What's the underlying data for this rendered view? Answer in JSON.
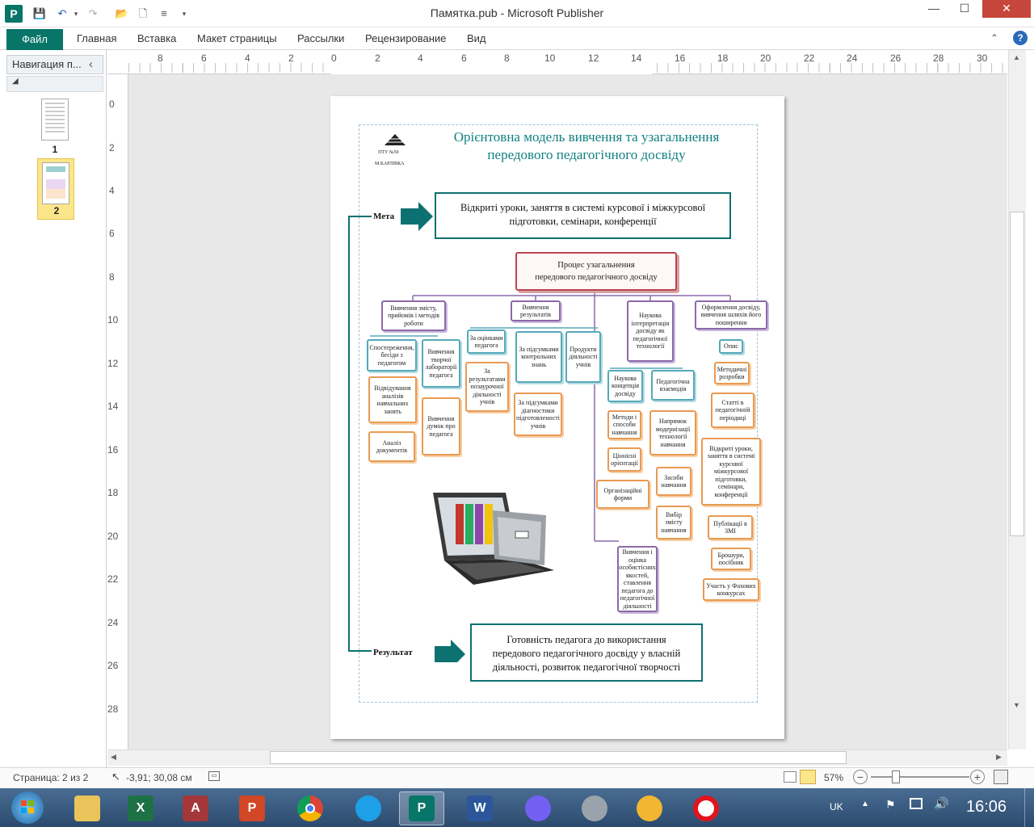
{
  "window": {
    "app_icon": "P",
    "title": "Памятка.pub  -  Microsoft Publisher",
    "controls": {
      "minimize": "—",
      "maximize": "☐",
      "close": "✕",
      "help": "?",
      "ribbon_toggle": "⌃"
    }
  },
  "quick_access": {
    "save": "💾",
    "undo": "↶",
    "redo": "↷",
    "open": "📂",
    "new": "🗋",
    "align": "≡",
    "more": "▾"
  },
  "ribbon": {
    "file_tab": "Файл",
    "tabs": [
      "Главная",
      "Вставка",
      "Макет страницы",
      "Рассылки",
      "Рецензирование",
      "Вид"
    ]
  },
  "nav_pane": {
    "title": "Навигация п...",
    "collapse": "‹",
    "section_toggle": "◢",
    "pages": [
      {
        "number": "1"
      },
      {
        "number": "2",
        "selected": true
      }
    ]
  },
  "ruler": {
    "horizontal": [
      "8",
      "6",
      "4",
      "2",
      "0",
      "2",
      "4",
      "6",
      "8",
      "10",
      "12",
      "14",
      "16",
      "18",
      "20",
      "22",
      "24",
      "26",
      "28",
      "30"
    ],
    "vertical": [
      "0",
      "2",
      "4",
      "6",
      "8",
      "10",
      "12",
      "14",
      "16",
      "18",
      "20",
      "22",
      "24",
      "26",
      "28"
    ]
  },
  "document": {
    "logo_line1": "ПТУ №50",
    "logo_line2": "М.КАРЛІВКА",
    "title_line1": "Орієнтовна модель вивчення та узагальнення",
    "title_line2": "передового педагогічного досвіду",
    "goal_label": "Мета",
    "goal_text_line1": "Відкриті уроки, заняття в системі курсової  і міжкурсової",
    "goal_text_line2": "підготовки, семінари, конференції",
    "process_line1": "Процес узагальнення",
    "process_line2": "передового педагогічного досвіду",
    "result_label": "Результат",
    "result_line1": "Готовність педагога до використання",
    "result_line2": "передового педагогічного досвіду у власній",
    "result_line3": "діяльності, розвиток педагогічної творчості",
    "nodes": {
      "n_content": "Вивчення змісту, прийомів і методів роботи",
      "n_results": "Вивчення результатів",
      "n_science": "Наукова інтерпретація досвіду як педагогічної технології",
      "n_design": "Оформлення досвіду, вивчення шляхів його поширення",
      "n_observe": "Спостереження, бесіди з педагогом",
      "n_lab": "Вивчення творчої лабораторії педагога",
      "n_visit": "Відвідування аналізів навчальних занять",
      "n_docs": "Аналіз документів",
      "n_opinion": "Вивчення думок про педагога",
      "n_grades": "За оцінками педагога",
      "n_control": "За підсумками контрольних знань",
      "n_products": "Продукти діяльності учнів",
      "n_extra": "За результатами позаурочної діяльності учнів",
      "n_diag": "За підсумками діагностики підготовленості учнів",
      "n_concept": "Наукова концепція досвіду",
      "n_interact": "Педагогічна взаємодія",
      "n_methods": "Методи і способи навчання",
      "n_values": "Ціннісні орієнтації",
      "n_forms": "Організаційні форми",
      "n_modern": "Напрямок модернізації технології навчання",
      "n_means": "Засоби навчання",
      "n_choice": "Вибір змісту навчання",
      "n_personal": "Вивчення і оцінка особистісних якостей, ставлення педагога до педагогічної діяльності",
      "n_desc": "Опис",
      "n_dev": "Методичні розробки",
      "n_articles": "Статті в педагогічній періодиці",
      "n_open": "Відкриті уроки, заняття в системі курсової міжкурсової підготовки, семінари, конференції",
      "n_media": "Публікації в ЗМІ",
      "n_booklets": "Брошури, посібник",
      "n_contests": "Участь у Фахових конкурсах"
    }
  },
  "status": {
    "page": "Страница: 2 из 2",
    "coords": "-3,91; 30,08 см",
    "zoom": "57%",
    "zoom_minus": "−",
    "zoom_plus": "+"
  },
  "taskbar": {
    "lang": "UK",
    "time": "16:06",
    "apps": [
      "start",
      "explorer",
      "excel",
      "access",
      "powerpoint",
      "chrome",
      "ie",
      "publisher",
      "word",
      "viber",
      "media",
      "vpn",
      "opera"
    ],
    "labels": {
      "excel": "X",
      "access": "A",
      "powerpoint": "P",
      "publisher": "P",
      "word": "W"
    }
  },
  "colors": {
    "accent": "#077568",
    "teal": "#0e7171",
    "purple": "#8a6aa8",
    "orange": "#e89a52",
    "taskbar": "#2b4a6e"
  }
}
